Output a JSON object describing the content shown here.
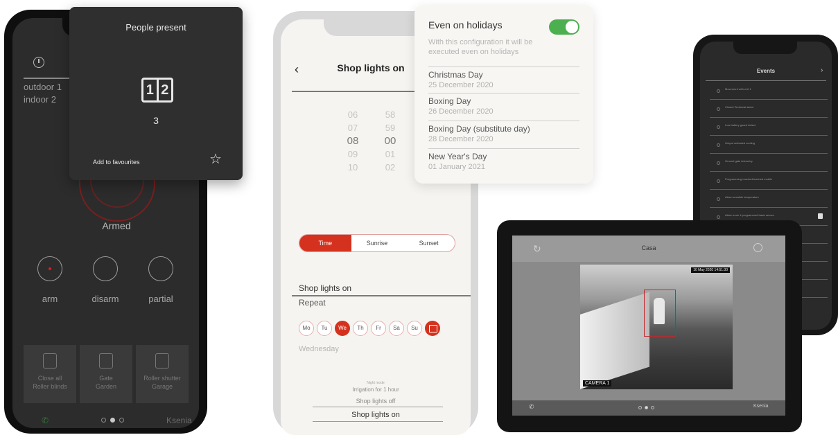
{
  "phone_alarm": {
    "temp_outdoor": "outdoor 1",
    "temp_indoor": "indoor 2",
    "status": "Armed",
    "modes": [
      "arm",
      "disarm",
      "partial"
    ],
    "tiles": [
      {
        "label": "Close all\nRoller blinds"
      },
      {
        "label": "Gate\nGarden"
      },
      {
        "label": "Roller shutter\nGarage"
      }
    ],
    "brand": "Ksenia",
    "popup": {
      "title": "People present",
      "counter_digits": [
        "1",
        "2"
      ],
      "count": "3",
      "favourites_label": "Add to favourites"
    }
  },
  "phone_schedule": {
    "back": "‹",
    "title": "Shop lights on",
    "picker_hours": [
      "06",
      "07",
      "08",
      "09",
      "10"
    ],
    "picker_minutes": [
      "58",
      "59",
      "00",
      "01",
      "02"
    ],
    "segments": [
      "Time",
      "Sunrise",
      "Sunset"
    ],
    "segment_selected": "Time",
    "name": "Shop lights on",
    "repeat_label": "Repeat",
    "days": [
      "Mo",
      "Tu",
      "We",
      "Th",
      "Fr",
      "Sa",
      "Su"
    ],
    "day_selected": "We",
    "day_selected_name": "Wednesday",
    "list_small": "Night mode",
    "list_irrigation": "Irrigation for 1 hour",
    "list_off": "Shop lights off",
    "list_on": "Shop lights on",
    "holidays": {
      "title": "Even on holidays",
      "toggle_on": true,
      "description": "With this configuration it will be executed even on holidays",
      "items": [
        {
          "name": "Christmas Day",
          "date": "25 December 2020"
        },
        {
          "name": "Boxing Day",
          "date": "26 December 2020"
        },
        {
          "name": "Boxing Day (substitute day)",
          "date": "28 December 2020"
        },
        {
          "name": "New Year's Day",
          "date": "01 January 2021"
        }
      ]
    }
  },
  "tablet": {
    "title": "Casa",
    "camera_label": "CAMERA 1",
    "camera_datetime": "10 May 2020 14:51:30"
  },
  "phone_events": {
    "title": "Events",
    "items": [
      "Movement with exit 1",
      "Closed Technical alarm",
      "Low battery guard detect",
      "Output activated cooling",
      "Ground gate telemetry",
      "Programming reached/reached mobile",
      "Alarm sensible temperature",
      "Alarm zone 4 programmed basic sensor"
    ]
  },
  "colors": {
    "accent_red": "#d4321f",
    "toggle_green": "#4caf50"
  }
}
